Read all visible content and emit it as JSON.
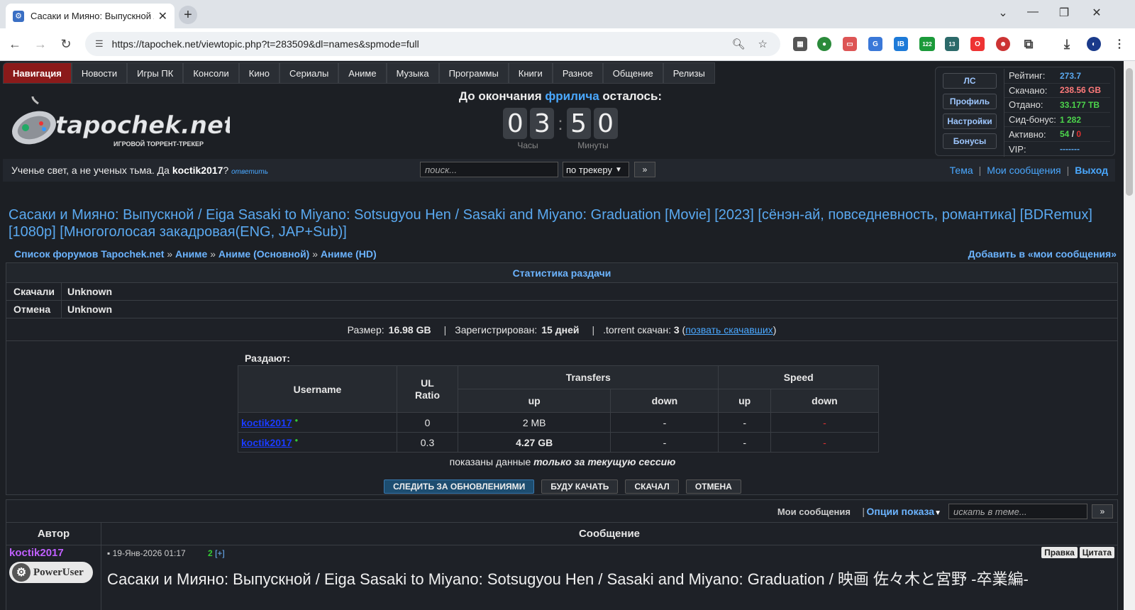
{
  "browser": {
    "tab_title": "Сасаки и Мияно: Выпускной /",
    "url": "https://tapochek.net/viewtopic.php?t=283509&dl=names&spmode=full",
    "ext_badges": [
      "122",
      "13"
    ]
  },
  "nav": {
    "items": [
      "Навигация",
      "Новости",
      "Игры ПК",
      "Консоли",
      "Кино",
      "Сериалы",
      "Аниме",
      "Музыка",
      "Программы",
      "Книги",
      "Разное",
      "Общение",
      "Релизы"
    ]
  },
  "logo": {
    "name": "tapochek.net",
    "tagline": "ИГРОВОЙ ТОРРЕНТ-ТРЕКЕР"
  },
  "freeleech": {
    "prefix": "До окончания",
    "highlight": "фрилича",
    "suffix": "осталось:",
    "digits": [
      "0",
      "3",
      "5",
      "0"
    ],
    "hours_label": "Часы",
    "minutes_label": "Минуты"
  },
  "userbox": {
    "buttons": [
      "ЛС",
      "Профиль",
      "Настройки",
      "Бонусы"
    ],
    "stats": [
      {
        "label": "Рейтинг:",
        "value": "273.7",
        "color": "#5aa9f0"
      },
      {
        "label": "Скачано:",
        "value": "238.56 GB",
        "color": "#ff7a7a"
      },
      {
        "label": "Отдано:",
        "value": "33.177 TB",
        "color": "#4cd44c"
      },
      {
        "label": "Сид-бонус:",
        "value": "1 282",
        "color": "#4cd44c"
      },
      {
        "label": "Активно:",
        "value_active": "54",
        "value_sep": "/",
        "value_inactive": "0"
      },
      {
        "label": "VIP:",
        "value": "-------",
        "color": "#5aa9f0"
      }
    ]
  },
  "greeting": {
    "text": "Ученье свет, а не ученых тьма. Да",
    "user": "koctik2017",
    "q": "?",
    "reply": "ответить"
  },
  "search": {
    "placeholder": "поиск...",
    "scope": "по трекеру",
    "go": "»"
  },
  "rightlinks": {
    "topic": "Тема",
    "my_messages": "Мои сообщения",
    "logout": "Выход"
  },
  "topic": {
    "title": "Сасаки и Мияно: Выпускной / Eiga Sasaki to Miyano: Sotsugyou Hen / Sasaki and Miyano: Graduation [Movie] [2023] [сёнэн-ай, повседневность, романтика] [BDRemux] [1080p] [Многоголосая закадровая(ENG, JAP+Sub)]"
  },
  "breadcrumbs": [
    "Список форумов Tapochek.net",
    "Аниме",
    "Аниме (Основной)",
    "Аниме (HD)"
  ],
  "add_favorites": "Добавить в «мои сообщения»",
  "stats": {
    "header": "Статистика раздачи",
    "downloaded_label": "Скачали",
    "downloaded_value": "Unknown",
    "cancel_label": "Отмена",
    "cancel_value": "Unknown",
    "size_label": "Размер:",
    "size_value": "16.98 GB",
    "registered_label": "Зарегистрирован:",
    "registered_value": "15 дней",
    "torrent_label": ".torrent скачан:",
    "torrent_value": "3",
    "call_link": "позвать скачавших",
    "seeders_label": "Раздают:",
    "columns": {
      "username": "Username",
      "ul_ratio": "UL Ratio",
      "transfers": "Transfers",
      "speed": "Speed",
      "up": "up",
      "down": "down"
    },
    "peers": [
      {
        "user": "koctik2017",
        "ratio": "0",
        "t_up": "2 MB",
        "t_down": "-",
        "s_up": "-",
        "s_down": "-"
      },
      {
        "user": "koctik2017",
        "ratio": "0.3",
        "t_up": "4.27 GB",
        "t_down": "-",
        "s_up": "-",
        "s_down": "-"
      }
    ],
    "session_prefix": "показаны данные",
    "session_bold": "только за текущую сессию"
  },
  "actions": [
    "СЛЕДИТЬ ЗА ОБНОВЛЕНИЯМИ",
    "БУДУ КАЧАТЬ",
    "СКАЧАЛ",
    "ОТМЕНА"
  ],
  "posts": {
    "my_messages": "Мои сообщения",
    "display_options": "Опции показа",
    "topic_search_placeholder": "искать в теме...",
    "go": "»",
    "col_author": "Автор",
    "col_message": "Сообщение",
    "author": "koctik2017",
    "rank": "PowerUser",
    "date": "19-Янв-2026 01:17",
    "count": "2",
    "count_link": "[+]",
    "edit": "Правка",
    "quote": "Цитата",
    "title": "Сасаки и Мияно: Выпускной / Eiga Sasaki to Miyano: Sotsugyou Hen / Sasaki and Miyano: Graduation / 映画 佐々木と宮野 -卒業編-"
  }
}
